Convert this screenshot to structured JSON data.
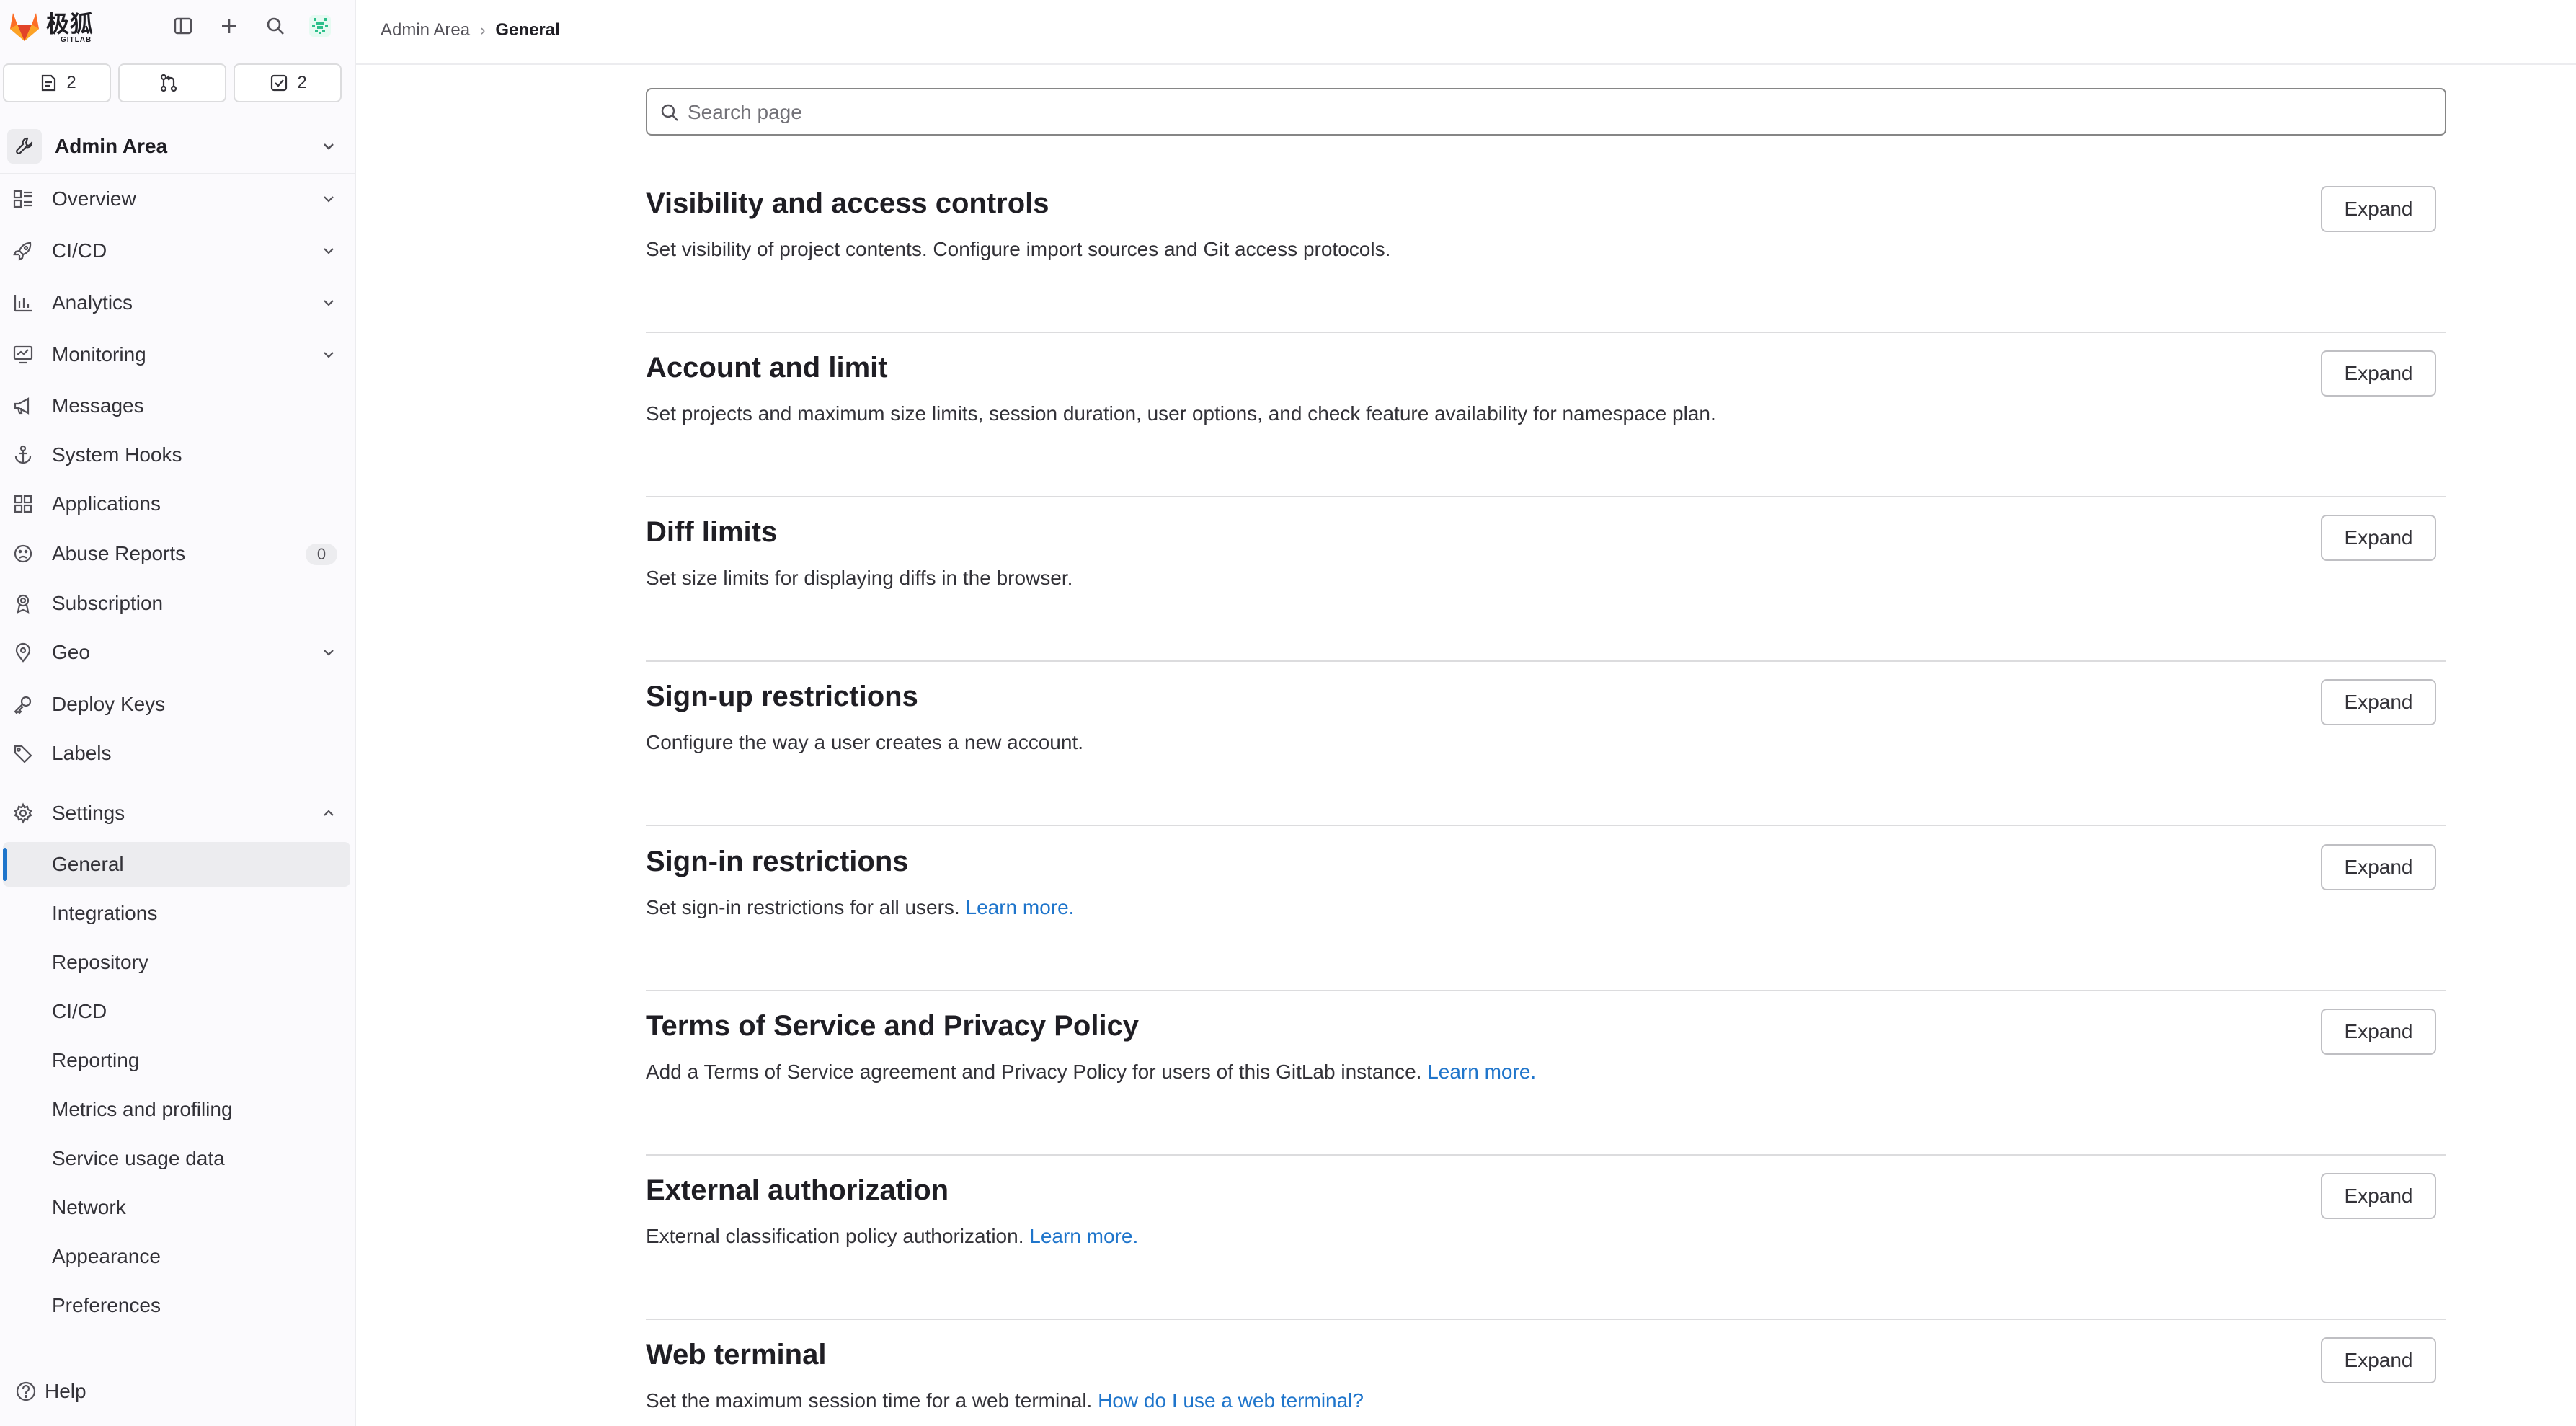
{
  "brand": {
    "name": "极狐",
    "sub": "GITLAB"
  },
  "counters": [
    {
      "icon": "issues-icon",
      "count": "2"
    },
    {
      "icon": "merge-request-icon",
      "count": ""
    },
    {
      "icon": "todo-icon",
      "count": "2"
    }
  ],
  "context": {
    "label": "Admin Area"
  },
  "nav": {
    "overview": "Overview",
    "cicd": "CI/CD",
    "analytics": "Analytics",
    "monitoring": "Monitoring",
    "messages": "Messages",
    "system_hooks": "System Hooks",
    "applications": "Applications",
    "abuse_reports": "Abuse Reports",
    "abuse_count": "0",
    "subscription": "Subscription",
    "geo": "Geo",
    "deploy_keys": "Deploy Keys",
    "labels": "Labels",
    "settings": "Settings"
  },
  "settings_sub": [
    "General",
    "Integrations",
    "Repository",
    "CI/CD",
    "Reporting",
    "Metrics and profiling",
    "Service usage data",
    "Network",
    "Appearance",
    "Preferences"
  ],
  "help": "Help",
  "breadcrumb": {
    "parent": "Admin Area",
    "current": "General"
  },
  "search": {
    "placeholder": "Search page",
    "value": ""
  },
  "expand_label": "Expand",
  "sections": [
    {
      "title": "Visibility and access controls",
      "desc": "Set visibility of project contents. Configure import sources and Git access protocols.",
      "link": ""
    },
    {
      "title": "Account and limit",
      "desc": "Set projects and maximum size limits, session duration, user options, and check feature availability for namespace plan.",
      "link": ""
    },
    {
      "title": "Diff limits",
      "desc": "Set size limits for displaying diffs in the browser.",
      "link": ""
    },
    {
      "title": "Sign-up restrictions",
      "desc": "Configure the way a user creates a new account.",
      "link": ""
    },
    {
      "title": "Sign-in restrictions",
      "desc": "Set sign-in restrictions for all users. ",
      "link": "Learn more."
    },
    {
      "title": "Terms of Service and Privacy Policy",
      "desc": "Add a Terms of Service agreement and Privacy Policy for users of this GitLab instance. ",
      "link": "Learn more."
    },
    {
      "title": "External authorization",
      "desc": "External classification policy authorization. ",
      "link": "Learn more."
    },
    {
      "title": "Web terminal",
      "desc": "Set the maximum session time for a web terminal. ",
      "link": "How do I use a web terminal?"
    }
  ],
  "colors": {
    "link": "#1f75cb",
    "active_indicator": "#1f75cb",
    "sidebar_bg": "#fbfafd",
    "brand_orange": "#e24329"
  }
}
